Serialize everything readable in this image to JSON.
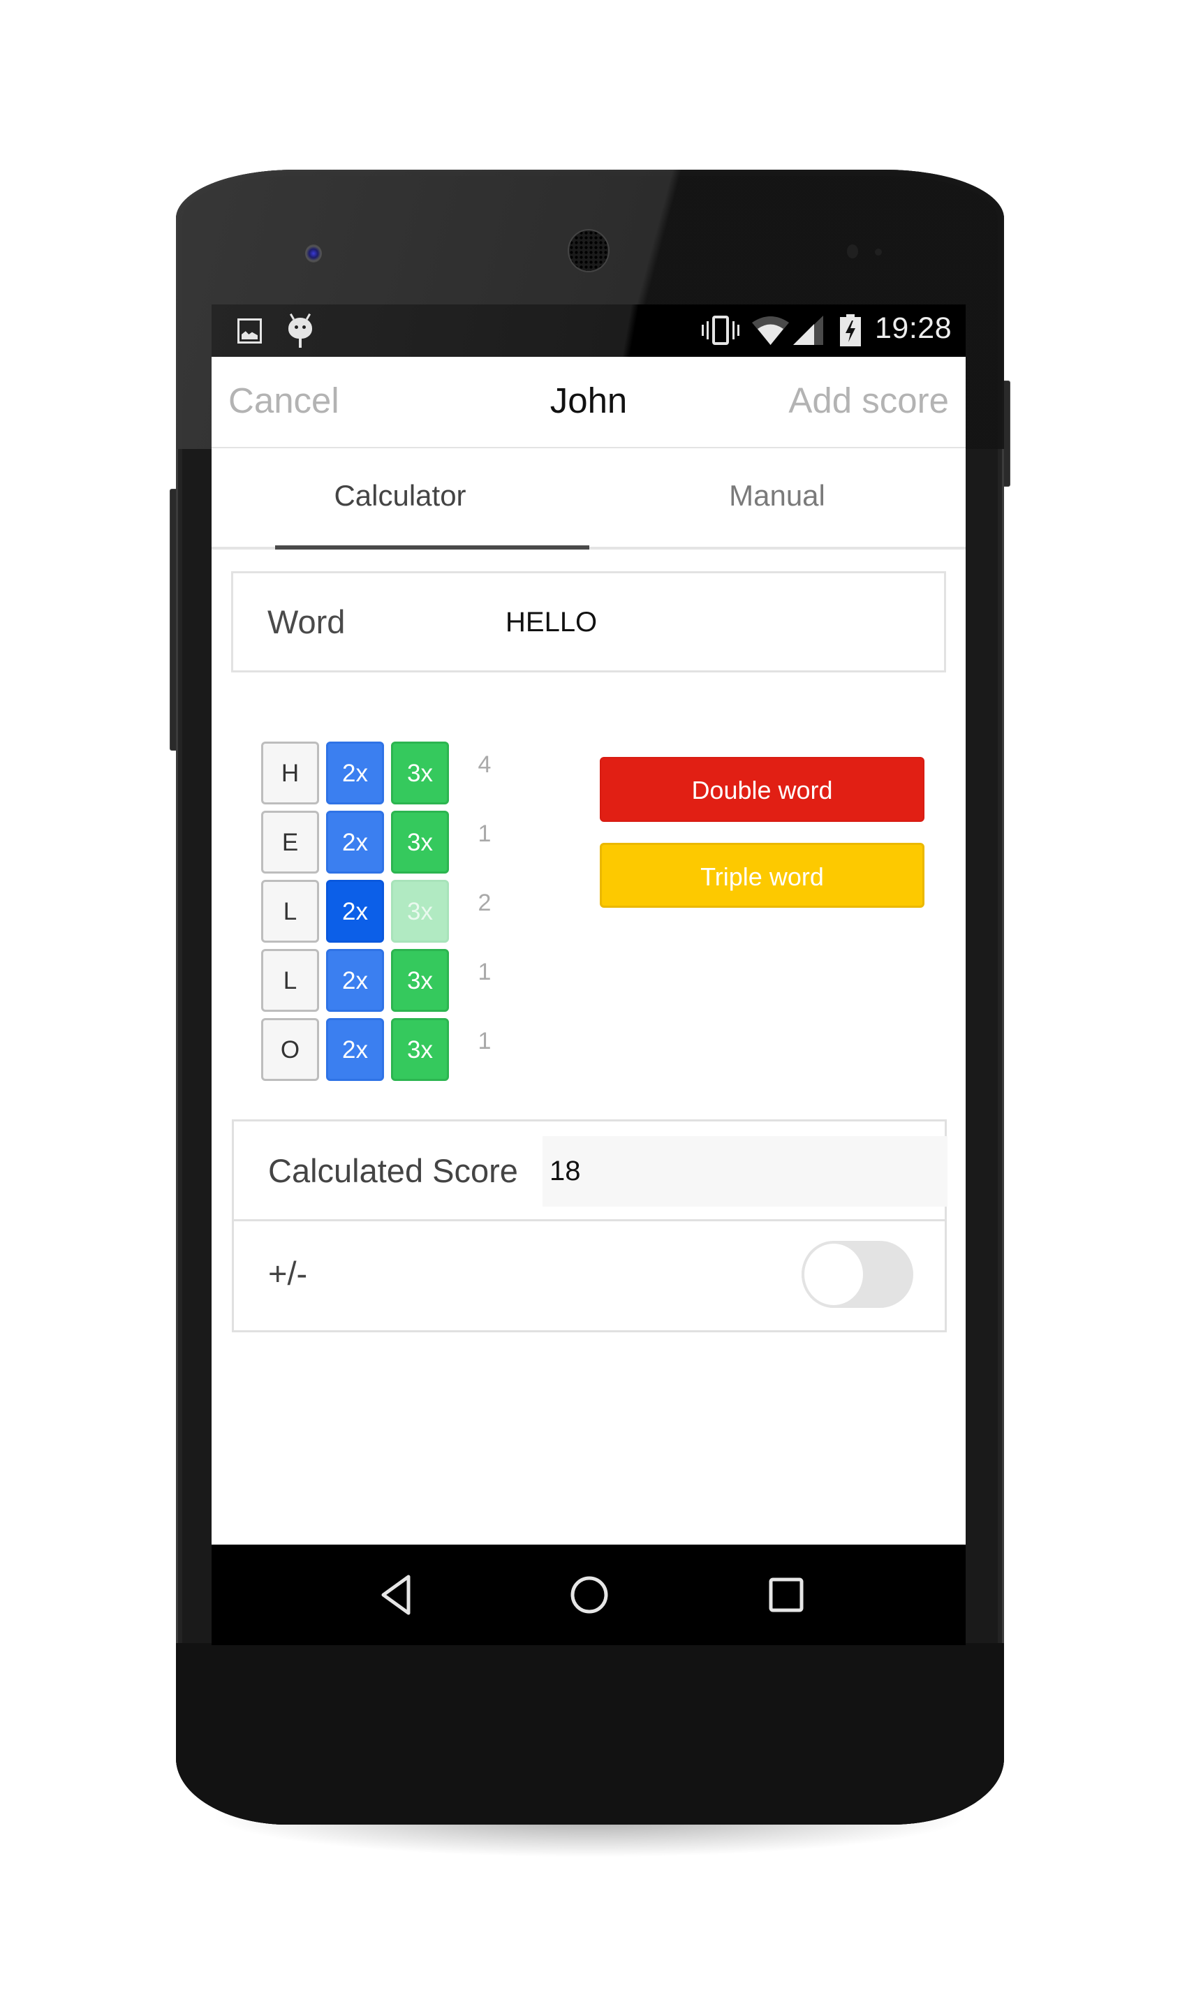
{
  "status_bar": {
    "left_icons": [
      "image-notification-icon",
      "android-debug-icon"
    ],
    "right_icons": [
      "vibrate-icon",
      "wifi-icon",
      "signal-icon",
      "battery-charging-icon"
    ],
    "time": "19:28"
  },
  "header": {
    "cancel_label": "Cancel",
    "title": "John",
    "add_score_label": "Add score"
  },
  "tabs": [
    {
      "label": "Calculator",
      "selected": true
    },
    {
      "label": "Manual",
      "selected": false
    }
  ],
  "word_field": {
    "label": "Word",
    "value": "HELLO"
  },
  "letters": [
    {
      "letter": "H",
      "double_label": "2x",
      "triple_label": "3x",
      "double_active": false,
      "triple_disabled": false,
      "score": "4"
    },
    {
      "letter": "E",
      "double_label": "2x",
      "triple_label": "3x",
      "double_active": false,
      "triple_disabled": false,
      "score": "1"
    },
    {
      "letter": "L",
      "double_label": "2x",
      "triple_label": "3x",
      "double_active": true,
      "triple_disabled": true,
      "score": "2"
    },
    {
      "letter": "L",
      "double_label": "2x",
      "triple_label": "3x",
      "double_active": false,
      "triple_disabled": false,
      "score": "1"
    },
    {
      "letter": "O",
      "double_label": "2x",
      "triple_label": "3x",
      "double_active": false,
      "triple_disabled": false,
      "score": "1"
    }
  ],
  "word_bonus": {
    "double_label": "Double word",
    "triple_label": "Triple word",
    "double_color": "#e11f14",
    "triple_color": "#fdc900"
  },
  "score": {
    "label": "Calculated Score",
    "value": "18",
    "adjust_label": "+/-",
    "adjust_toggle_on": false
  },
  "colors": {
    "double_letter": "#3b7ff0",
    "double_letter_active": "#0c5fe8",
    "triple_letter": "#35c95d",
    "triple_letter_disabled": "#b1eac2"
  },
  "nav_bar": {
    "buttons": [
      "back-icon",
      "home-icon",
      "recent-apps-icon"
    ]
  }
}
